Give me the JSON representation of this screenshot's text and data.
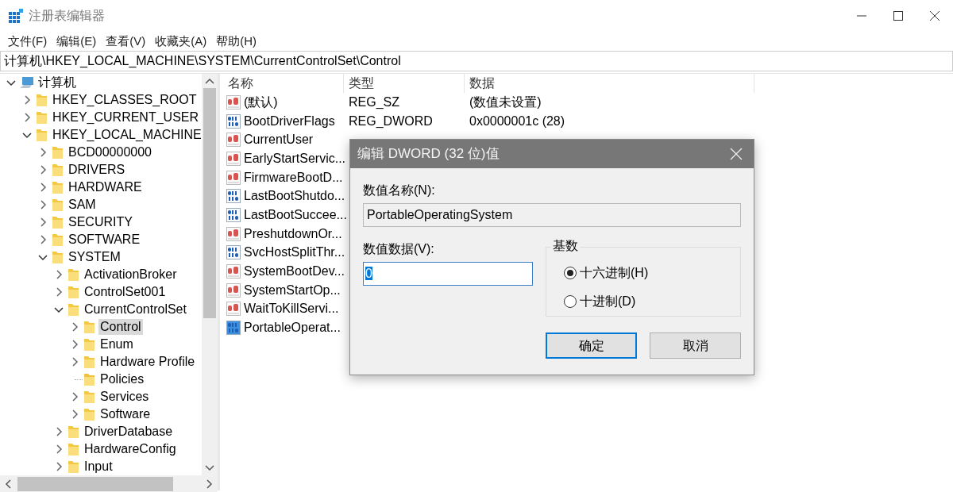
{
  "window": {
    "title": "注册表编辑器"
  },
  "menu": [
    "文件(F)",
    "编辑(E)",
    "查看(V)",
    "收藏夹(A)",
    "帮助(H)"
  ],
  "address": "计算机\\HKEY_LOCAL_MACHINE\\SYSTEM\\CurrentControlSet\\Control",
  "tree": {
    "label": "计算机",
    "kind": "computer",
    "expanded": true,
    "selected": false,
    "children": [
      {
        "label": "HKEY_CLASSES_ROOT",
        "kind": "folder",
        "expanded": false,
        "selected": false
      },
      {
        "label": "HKEY_CURRENT_USER",
        "kind": "folder",
        "expanded": false,
        "selected": false
      },
      {
        "label": "HKEY_LOCAL_MACHINE",
        "kind": "folder",
        "expanded": true,
        "selected": false,
        "children": [
          {
            "label": "BCD00000000",
            "kind": "folder",
            "expanded": false,
            "selected": false
          },
          {
            "label": "DRIVERS",
            "kind": "folder",
            "expanded": false,
            "selected": false
          },
          {
            "label": "HARDWARE",
            "kind": "folder",
            "expanded": false,
            "selected": false
          },
          {
            "label": "SAM",
            "kind": "folder",
            "expanded": false,
            "selected": false
          },
          {
            "label": "SECURITY",
            "kind": "folder",
            "expanded": false,
            "selected": false
          },
          {
            "label": "SOFTWARE",
            "kind": "folder",
            "expanded": false,
            "selected": false
          },
          {
            "label": "SYSTEM",
            "kind": "folder",
            "expanded": true,
            "selected": false,
            "children": [
              {
                "label": "ActivationBroker",
                "kind": "folder",
                "expanded": false,
                "selected": false
              },
              {
                "label": "ControlSet001",
                "kind": "folder",
                "expanded": false,
                "selected": false
              },
              {
                "label": "CurrentControlSet",
                "kind": "folder",
                "expanded": true,
                "selected": false,
                "children": [
                  {
                    "label": "Control",
                    "kind": "folder",
                    "expanded": false,
                    "selected": true
                  },
                  {
                    "label": "Enum",
                    "kind": "folder",
                    "expanded": false,
                    "selected": false
                  },
                  {
                    "label": "Hardware Profile",
                    "kind": "folder",
                    "expanded": false,
                    "selected": false
                  },
                  {
                    "label": "Policies",
                    "kind": "leaf",
                    "expanded": false,
                    "selected": false
                  },
                  {
                    "label": "Services",
                    "kind": "folder",
                    "expanded": false,
                    "selected": false
                  },
                  {
                    "label": "Software",
                    "kind": "folder",
                    "expanded": false,
                    "selected": false
                  }
                ]
              },
              {
                "label": "DriverDatabase",
                "kind": "folder",
                "expanded": false,
                "selected": false
              },
              {
                "label": "HardwareConfig",
                "kind": "folder",
                "expanded": false,
                "selected": false
              },
              {
                "label": "Input",
                "kind": "folder",
                "expanded": false,
                "selected": false
              }
            ]
          }
        ]
      }
    ]
  },
  "values": {
    "columns": [
      "名称",
      "类型",
      "数据"
    ],
    "rows": [
      {
        "name": "(默认)",
        "type": "REG_SZ",
        "data": "(数值未设置)",
        "kind": "string",
        "selected": false
      },
      {
        "name": "BootDriverFlags",
        "type": "REG_DWORD",
        "data": "0x0000001c (28)",
        "kind": "binary",
        "selected": false
      },
      {
        "name": "CurrentUser",
        "kind": "string",
        "selected": false
      },
      {
        "name": "EarlyStartServic...",
        "kind": "string",
        "selected": false
      },
      {
        "name": "FirmwareBootD...",
        "kind": "string",
        "selected": false
      },
      {
        "name": "LastBootShutdo...",
        "kind": "binary",
        "selected": false
      },
      {
        "name": "LastBootSuccee...",
        "kind": "binary",
        "selected": false
      },
      {
        "name": "PreshutdownOr...",
        "kind": "string",
        "selected": false
      },
      {
        "name": "SvcHostSplitThr...",
        "kind": "binary",
        "selected": false
      },
      {
        "name": "SystemBootDev...",
        "kind": "string",
        "selected": false
      },
      {
        "name": "SystemStartOp...",
        "kind": "string",
        "selected": false
      },
      {
        "name": "WaitToKillServi...",
        "kind": "string",
        "selected": false
      },
      {
        "name": "PortableOperat...",
        "kind": "binary",
        "selected": true
      }
    ]
  },
  "dialog": {
    "title": "编辑 DWORD (32 位)值",
    "name_label": "数值名称(N):",
    "name_value": "PortableOperatingSystem",
    "data_label": "数值数据(V):",
    "data_value": "0",
    "base": {
      "label": "基数",
      "options": [
        {
          "label": "十六进制(H)",
          "selected": true
        },
        {
          "label": "十进制(D)",
          "selected": false
        }
      ]
    },
    "buttons": [
      {
        "label": "确定",
        "default": true
      },
      {
        "label": "取消",
        "default": false
      }
    ]
  }
}
